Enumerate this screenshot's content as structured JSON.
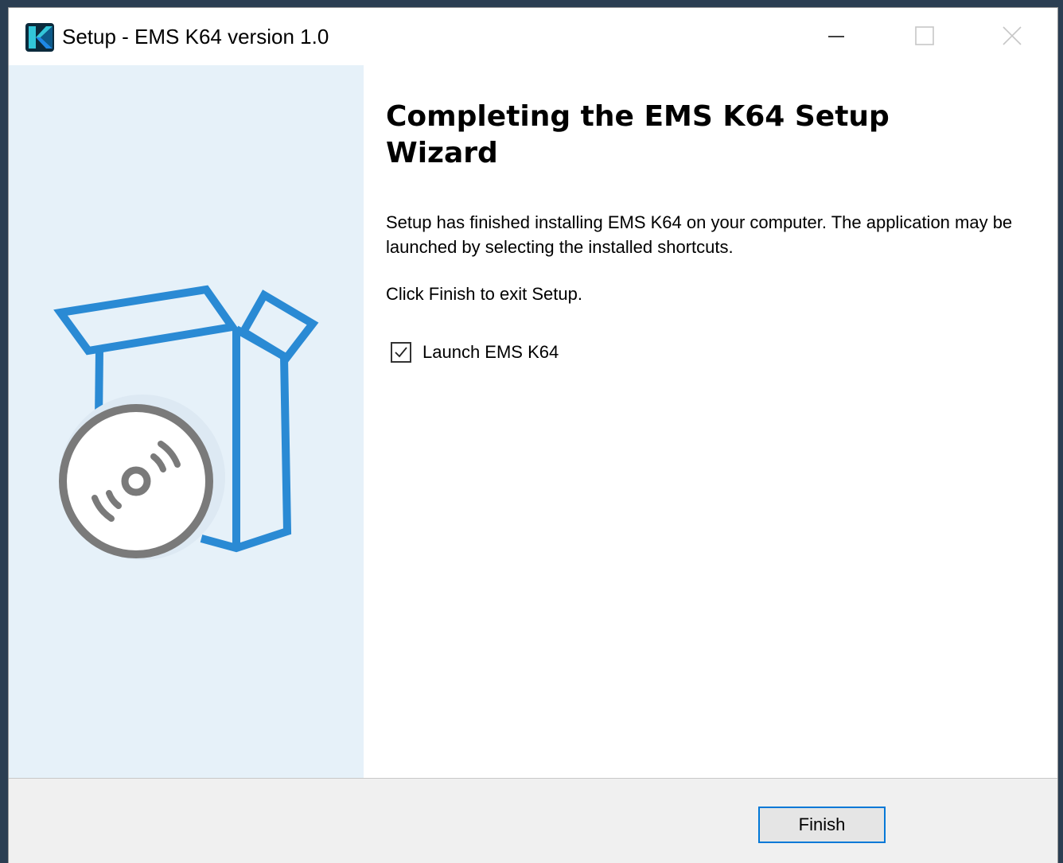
{
  "window": {
    "title": "Setup - EMS K64 version 1.0",
    "app_icon": "ems-k64-app-icon",
    "controls": {
      "minimize_icon": "minimize-icon",
      "maximize_icon": "maximize-icon",
      "close_icon": "close-icon"
    }
  },
  "side_panel": {
    "illustration": "software-box-with-disc-icon",
    "background_color": "#e6f1f9",
    "accent_color": "#2a8ad4",
    "disc_color": "#7a7a7a"
  },
  "main": {
    "heading": "Completing the EMS K64 Setup Wizard",
    "description": "Setup has finished installing EMS K64 on your computer. The application may be launched by selecting the installed shortcuts.",
    "hint": "Click Finish to exit Setup.",
    "launch_checkbox": {
      "label": "Launch EMS K64",
      "checked": true
    }
  },
  "footer": {
    "finish_label": "Finish",
    "button_border_color": "#0078d7"
  }
}
